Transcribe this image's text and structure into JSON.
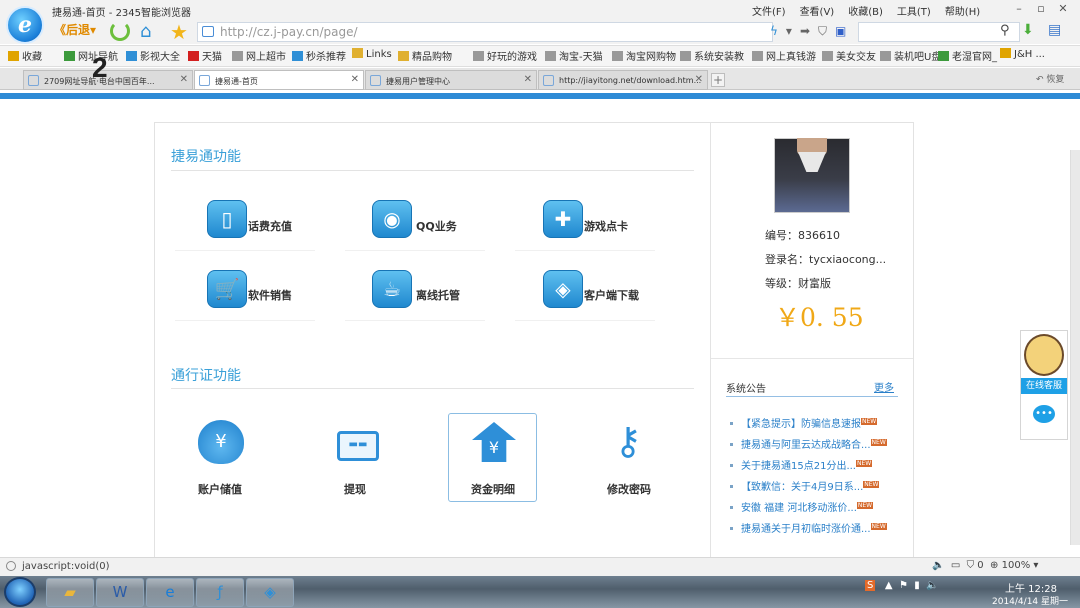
{
  "window": {
    "title": "捷易通-首页 - 2345智能浏览器"
  },
  "menu": [
    "文件(F)",
    "查看(V)",
    "收藏(B)",
    "工具(T)",
    "帮助(H)"
  ],
  "nav": {
    "back_label": "后退",
    "url": "http://cz.j-pay.cn/page/"
  },
  "favorites": [
    {
      "label": "收藏",
      "color": "#e0a400"
    },
    {
      "label": "网址导航",
      "color": "#3c9a3c"
    },
    {
      "label": "影视大全",
      "color": "#2f8fd6"
    },
    {
      "label": "天猫",
      "color": "#d31f1f"
    },
    {
      "label": "网上超市",
      "color": "#999999"
    },
    {
      "label": "秒杀推荐",
      "color": "#2f8fd6"
    },
    {
      "label": "Links",
      "color": "#e0b030"
    },
    {
      "label": "精品购物",
      "color": "#e0b030"
    },
    {
      "label": "好玩的游戏",
      "color": "#999999"
    },
    {
      "label": "淘宝-天猫",
      "color": "#999999"
    },
    {
      "label": "淘宝网购物",
      "color": "#999999"
    },
    {
      "label": "系统安装教",
      "color": "#999999"
    },
    {
      "label": "网上真钱游",
      "color": "#999999"
    },
    {
      "label": "美女交友",
      "color": "#999999"
    },
    {
      "label": "装机吧U盘",
      "color": "#999999"
    },
    {
      "label": "老湿官网_",
      "color": "#3c9a3c"
    },
    {
      "label": "J&H ...",
      "color": "#e0a400"
    }
  ],
  "tabs": [
    {
      "label": "2709网址导航·电台中国百年...",
      "active": false
    },
    {
      "label": "捷易通-首页",
      "active": true
    },
    {
      "label": "捷易用户管理中心",
      "active": false
    },
    {
      "label": "http://jiayitong.net/download.htm...",
      "active": false
    }
  ],
  "tab_undo": "恢复",
  "overlay_numeral": "2",
  "sections": {
    "jyt": {
      "title": "捷易通功能",
      "items": [
        {
          "label": "话费充值",
          "icon": "phone-icon",
          "glyph": "▯"
        },
        {
          "label": "QQ业务",
          "icon": "qq-icon",
          "glyph": "◉"
        },
        {
          "label": "游戏点卡",
          "icon": "gamepad-icon",
          "glyph": "✚"
        },
        {
          "label": "软件销售",
          "icon": "cart-icon",
          "glyph": "🛒"
        },
        {
          "label": "离线托管",
          "icon": "coffee-icon",
          "glyph": "☕"
        },
        {
          "label": "客户端下载",
          "icon": "client-logo-icon",
          "glyph": "◈"
        }
      ]
    },
    "pass": {
      "title": "通行证功能",
      "items": [
        {
          "label": "账户储值",
          "icon": "money-bag-icon",
          "glyph": "¥"
        },
        {
          "label": "提现",
          "icon": "card-icon",
          "glyph": "▭"
        },
        {
          "label": "资金明细",
          "icon": "funds-detail-icon",
          "glyph": "¥"
        },
        {
          "label": "修改密码",
          "icon": "key-icon",
          "glyph": "⚷"
        }
      ]
    }
  },
  "account": {
    "id_line": "编号：836610",
    "login_line": "登录名：tycxiaocong...",
    "level_line": "等级：财富版",
    "balance": "￥0. 55"
  },
  "notices": {
    "title": "系统公告",
    "more": "更多",
    "new_badge": "NEW",
    "items": [
      "【紧急提示】防骗信息速报",
      "捷易通与阿里云达成战略合...",
      "关于捷易通15点21分出...",
      "【致歉信：关于4月9日系...",
      "安徽 福建 河北移动涨价...",
      "捷易通关于月初临时涨价通..."
    ]
  },
  "service": {
    "label": "在线客服"
  },
  "status": {
    "text": "javascript:void(0)",
    "zoom": "100%"
  },
  "clock": {
    "time": "上午 12:28",
    "date": "2014/4/14 星期一"
  },
  "colors": {
    "accent": "#2d8ad5",
    "section_title": "#3aa0d8",
    "balance": "#f0a817",
    "notice_link": "#2b80c9"
  }
}
